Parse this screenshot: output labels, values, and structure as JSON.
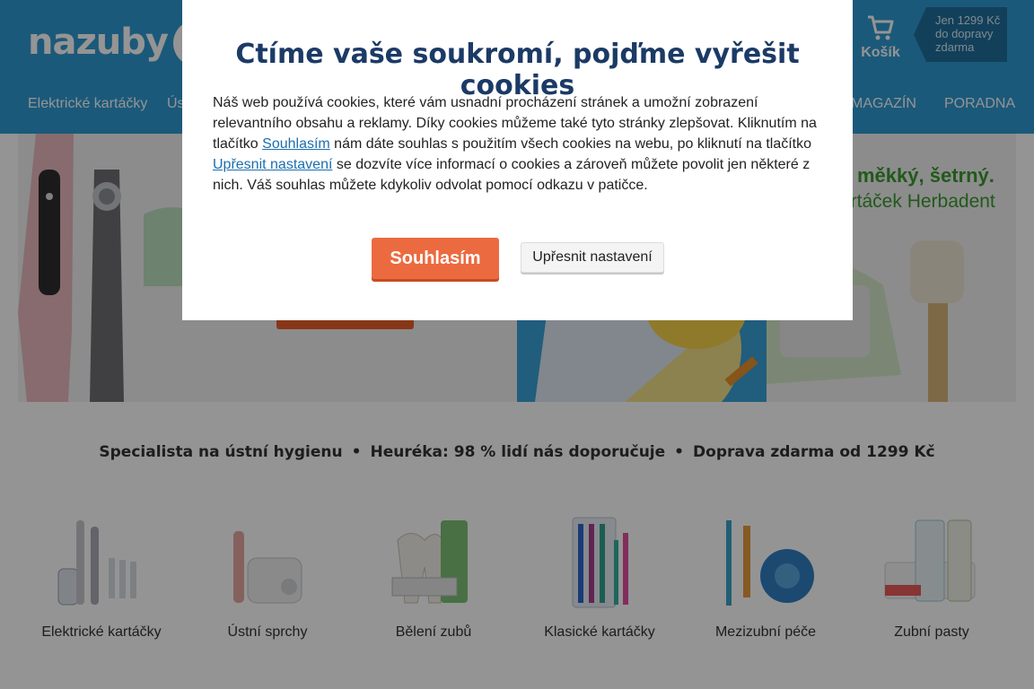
{
  "header": {
    "logo": "nazuby",
    "cart_label": "Košík",
    "shipping_badge": [
      "Jen 1299 Kč",
      "do dopravy",
      "zdarma"
    ],
    "nav": [
      "Elektrické kartáčky",
      "Ús",
      "MAGAZÍN",
      "PORADNA"
    ]
  },
  "banners": {
    "right_title": "měkký, šetrný.",
    "right_sub": "artáček Herbadent"
  },
  "usp": [
    "Specialista na ústní hygienu",
    "Heuréka: 98 % lidí nás doporučuje",
    "Doprava zdarma od 1299 Kč"
  ],
  "categories": [
    {
      "label": "Elektrické kartáčky",
      "icon": "electric-toothbrush-icon"
    },
    {
      "label": "Ústní sprchy",
      "icon": "oral-irrigator-icon"
    },
    {
      "label": "Bělení zubů",
      "icon": "teeth-whitening-icon"
    },
    {
      "label": "Klasické kartáčky",
      "icon": "manual-toothbrush-icon"
    },
    {
      "label": "Mezizubní péče",
      "icon": "interdental-care-icon"
    },
    {
      "label": "Zubní pasty",
      "icon": "toothpaste-icon"
    }
  ],
  "cookie_modal": {
    "title": "Ctíme vaše soukromí, pojďme vyřešit cookies",
    "text_1": "Náš web používá cookies, které vám usnadní procházení stránek a umožní zobrazení relevantního obsahu a reklamy. Díky cookies můžeme také tyto stránky zlepšovat. Kliknutím na tlačítko ",
    "link_accept": "Souhlasím",
    "text_2": " nám dáte souhlas s použitím všech cookies na webu, po kliknutí na tlačítko ",
    "link_settings": "Upřesnit nastavení",
    "text_3": " se dozvíte více informací o cookies a zároveň můžete povolit jen některé z nich. Váš souhlas můžete kdykoliv odvolat pomocí odkazu v patičce.",
    "accept_button": "Souhlasím",
    "settings_button": "Upřesnit nastavení"
  },
  "colors": {
    "brand": "#2f9ad3",
    "accent": "#ec6a3f",
    "title": "#1b3a66"
  }
}
